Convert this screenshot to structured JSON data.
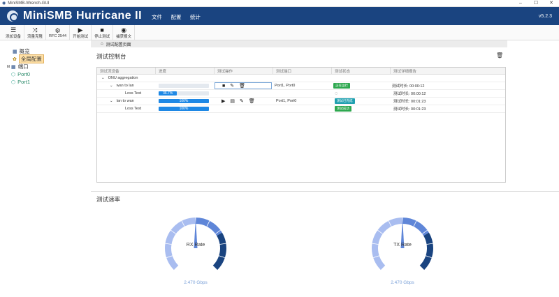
{
  "window": {
    "title": "MiniSMB-Wrench-GUI",
    "controls": [
      "–",
      "☐",
      "✕"
    ]
  },
  "app": {
    "title": "MiniSMB Hurricane II",
    "version": "v5.2.3",
    "menu": [
      "文件",
      "配置",
      "统计"
    ]
  },
  "toolbar": [
    {
      "icon": "server-icon",
      "label": "添加设备"
    },
    {
      "icon": "shuffle-icon",
      "label": "流量克隆"
    },
    {
      "icon": "rfc-icon",
      "label": "RFC 2544"
    },
    {
      "icon": "play-icon",
      "label": "开始测试"
    },
    {
      "icon": "stop-icon",
      "label": "停止测试"
    },
    {
      "icon": "eye-icon",
      "label": "捕获报文"
    }
  ],
  "sidebar": {
    "overview": "概览",
    "global_config": "全局配置",
    "ports_label": "端口",
    "ports": [
      "Port0",
      "Port1"
    ]
  },
  "breadcrumb": "测试配置页面",
  "console": {
    "title": "测试控制台",
    "headers": [
      "测试流设备",
      "进度",
      "测试操作",
      "测试端口",
      "测试状态",
      "测试详细报告"
    ],
    "group": "ONU aggregation",
    "rows": [
      {
        "name": "wan to lan",
        "progress": 0,
        "progress_label": "",
        "ops": "running",
        "port": "Port1, Port0",
        "status": "正在运行",
        "status_color": "#2ea84f",
        "report": "测试时长: 00:00:12"
      },
      {
        "name": "Loss Test",
        "progress": 0.367,
        "progress_label": "36.7%",
        "ops": "",
        "port": "",
        "status": "spinner",
        "status_color": "",
        "report": "测试时长: 00:00:12"
      },
      {
        "name": "lan to wan",
        "progress": 1,
        "progress_label": "100%",
        "ops": "idle",
        "port": "Port1, Port0",
        "status": "测试已完成",
        "status_color": "#20a0b0",
        "report": "测试时长: 00:01:23"
      },
      {
        "name": "Loss Test",
        "progress": 1,
        "progress_label": "100%",
        "ops": "",
        "port": "",
        "status": "测试成功",
        "status_color": "#2ea84f",
        "report": "测试时长: 00:01:23"
      }
    ]
  },
  "speed": {
    "title": "测试速率",
    "gauges": [
      {
        "label": "RX Rate",
        "value_text": "2.470 Gbps",
        "needle_fraction": 0.5
      },
      {
        "label": "TX Rate",
        "value_text": "2.470 Gbps",
        "needle_fraction": 0.5
      }
    ],
    "colors": {
      "light": "#a9bdf0",
      "mid": "#5f86d8",
      "dark": "#1a4480"
    }
  }
}
